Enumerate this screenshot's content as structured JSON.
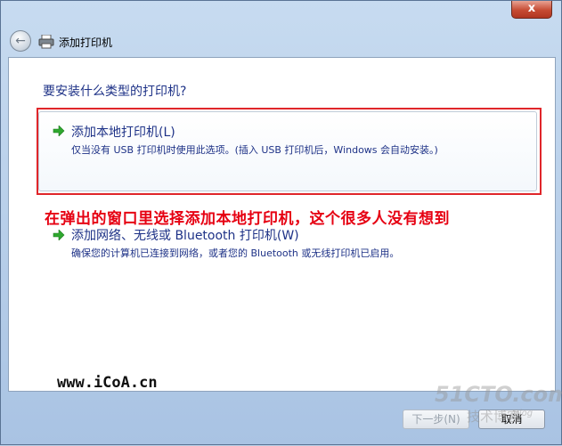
{
  "window": {
    "close_label": "x",
    "back_symbol": "←",
    "title": "添加打印机"
  },
  "content": {
    "question": "要安装什么类型的打印机?",
    "options": [
      {
        "title": "添加本地打印机(L)",
        "description": "仅当没有 USB 打印机时使用此选项。(插入 USB 打印机后，Windows 会自动安装。)",
        "icon": "green-arrow-icon"
      },
      {
        "title": "添加网络、无线或 Bluetooth 打印机(W)",
        "description": "确保您的计算机已连接到网络，或者您的 Bluetooth 或无线打印机已启用。",
        "icon": "green-arrow-icon"
      }
    ],
    "annotation": "在弹出的窗口里选择添加本地打印机，这个很多人没有想到",
    "site": "www.iCoA.cn"
  },
  "footer": {
    "next_label": "下一步(N)",
    "cancel_label": "取消"
  },
  "watermark": {
    "brand": "51CTO.com",
    "sub": "技术博客",
    "blog": "Blog"
  },
  "colors": {
    "accent_text": "#1e3287",
    "annotation": "#e60012",
    "highlight_border": "#e0262a",
    "arrow": "#2fa82f"
  }
}
